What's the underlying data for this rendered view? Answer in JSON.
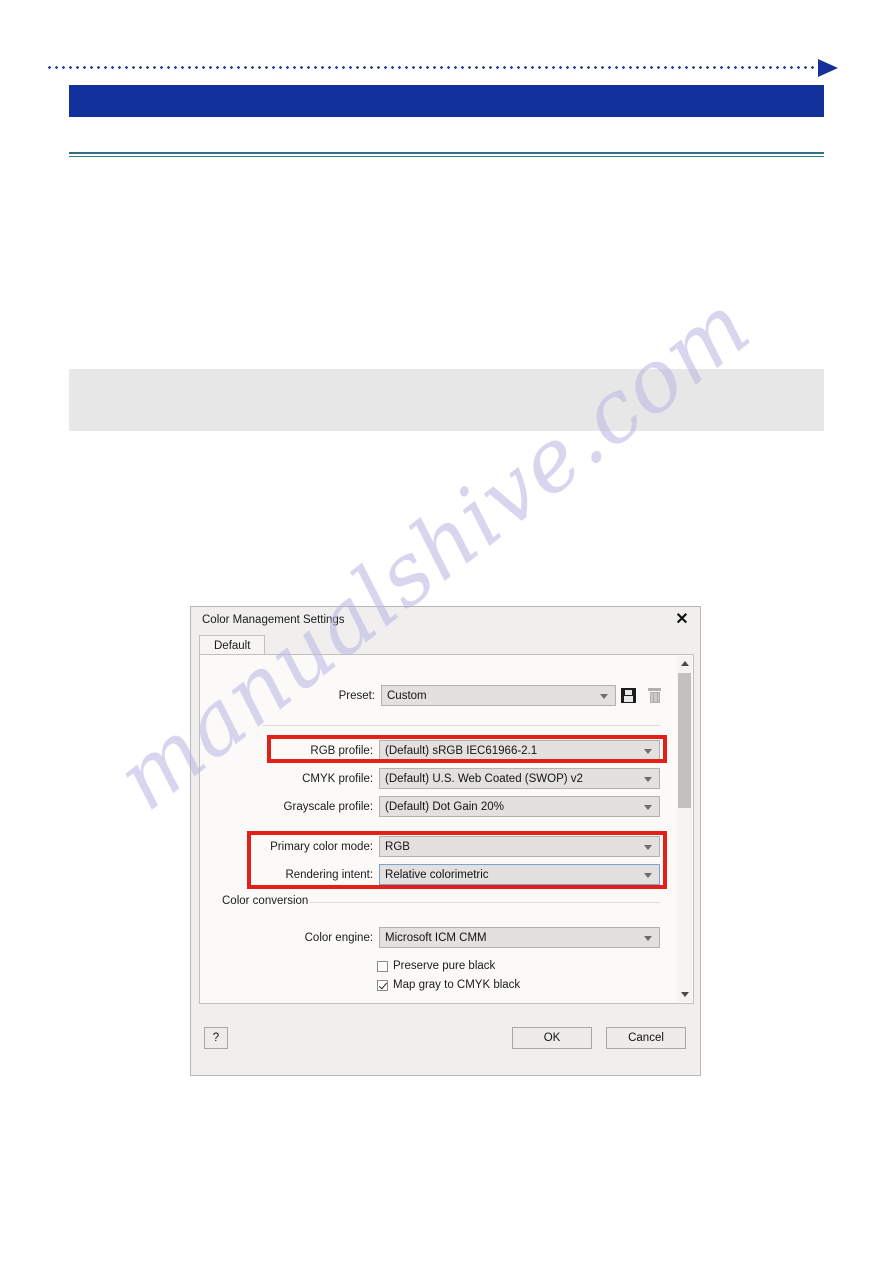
{
  "page": {
    "header_title": "",
    "watermark": "manualshive.com",
    "accent_blue": "#12319b",
    "rule_teal": "#2f6f84",
    "highlight_red": "#e32017"
  },
  "dialog": {
    "title": "Color Management Settings",
    "close_icon": "✕",
    "tabs": [
      {
        "label": "Default"
      }
    ],
    "preset": {
      "label": "Preset:",
      "value": "Custom",
      "save_icon": "save-icon",
      "delete_icon": "trash-icon"
    },
    "profiles": [
      {
        "label": "RGB profile:",
        "value": "(Default) sRGB IEC61966-2.1",
        "highlighted": true
      },
      {
        "label": "CMYK profile:",
        "value": "(Default) U.S. Web Coated (SWOP) v2",
        "highlighted": false
      },
      {
        "label": "Grayscale profile:",
        "value": "(Default) Dot Gain 20%",
        "highlighted": false
      }
    ],
    "modes": [
      {
        "label": "Primary color mode:",
        "value": "RGB"
      },
      {
        "label": "Rendering intent:",
        "value": "Relative colorimetric"
      }
    ],
    "color_conversion": {
      "section_label": "Color conversion",
      "engine": {
        "label": "Color engine:",
        "value": "Microsoft ICM CMM"
      },
      "checkboxes": [
        {
          "label": "Preserve pure black",
          "checked": false
        },
        {
          "label": "Map gray to CMYK black",
          "checked": true
        }
      ]
    },
    "scrollbar": {
      "up_icon": "chevron-up-icon",
      "down_icon": "chevron-down-icon"
    },
    "footer": {
      "help_label": "?",
      "ok_label": "OK",
      "cancel_label": "Cancel"
    }
  }
}
